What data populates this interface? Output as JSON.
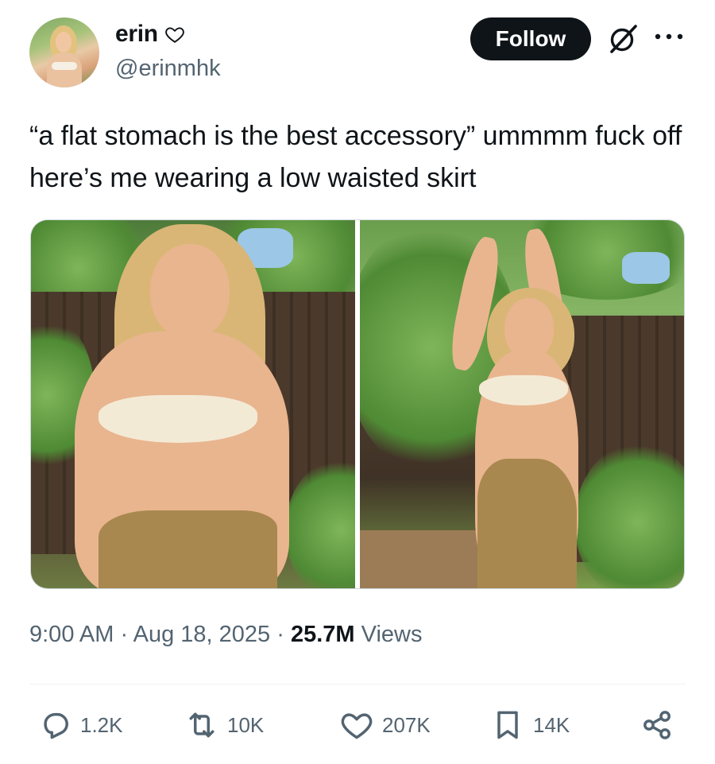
{
  "tweet": {
    "author": {
      "display_name": "erin",
      "handle": "@erinmhk",
      "name_badge_icon": "heart-outline-icon",
      "avatar_icon": "profile-photo"
    },
    "follow_label": "Follow",
    "text": "“a flat stomach is the best accessory” ummmm fuck off here’s me wearing a low waisted skirt",
    "media": [
      {
        "icon": "photo-woman-garden-1"
      },
      {
        "icon": "photo-woman-garden-2"
      }
    ],
    "time": "9:00 AM",
    "date": "Aug 18, 2025",
    "views_count": "25.7M",
    "views_label": "Views",
    "separator": "·"
  },
  "actions": {
    "replies": "1.2K",
    "reposts": "10K",
    "likes": "207K",
    "bookmarks": "14K"
  },
  "colors": {
    "text_primary": "#0f1419",
    "text_secondary": "#536471",
    "follow_bg": "#0f1419",
    "divider": "#eff3f4"
  }
}
